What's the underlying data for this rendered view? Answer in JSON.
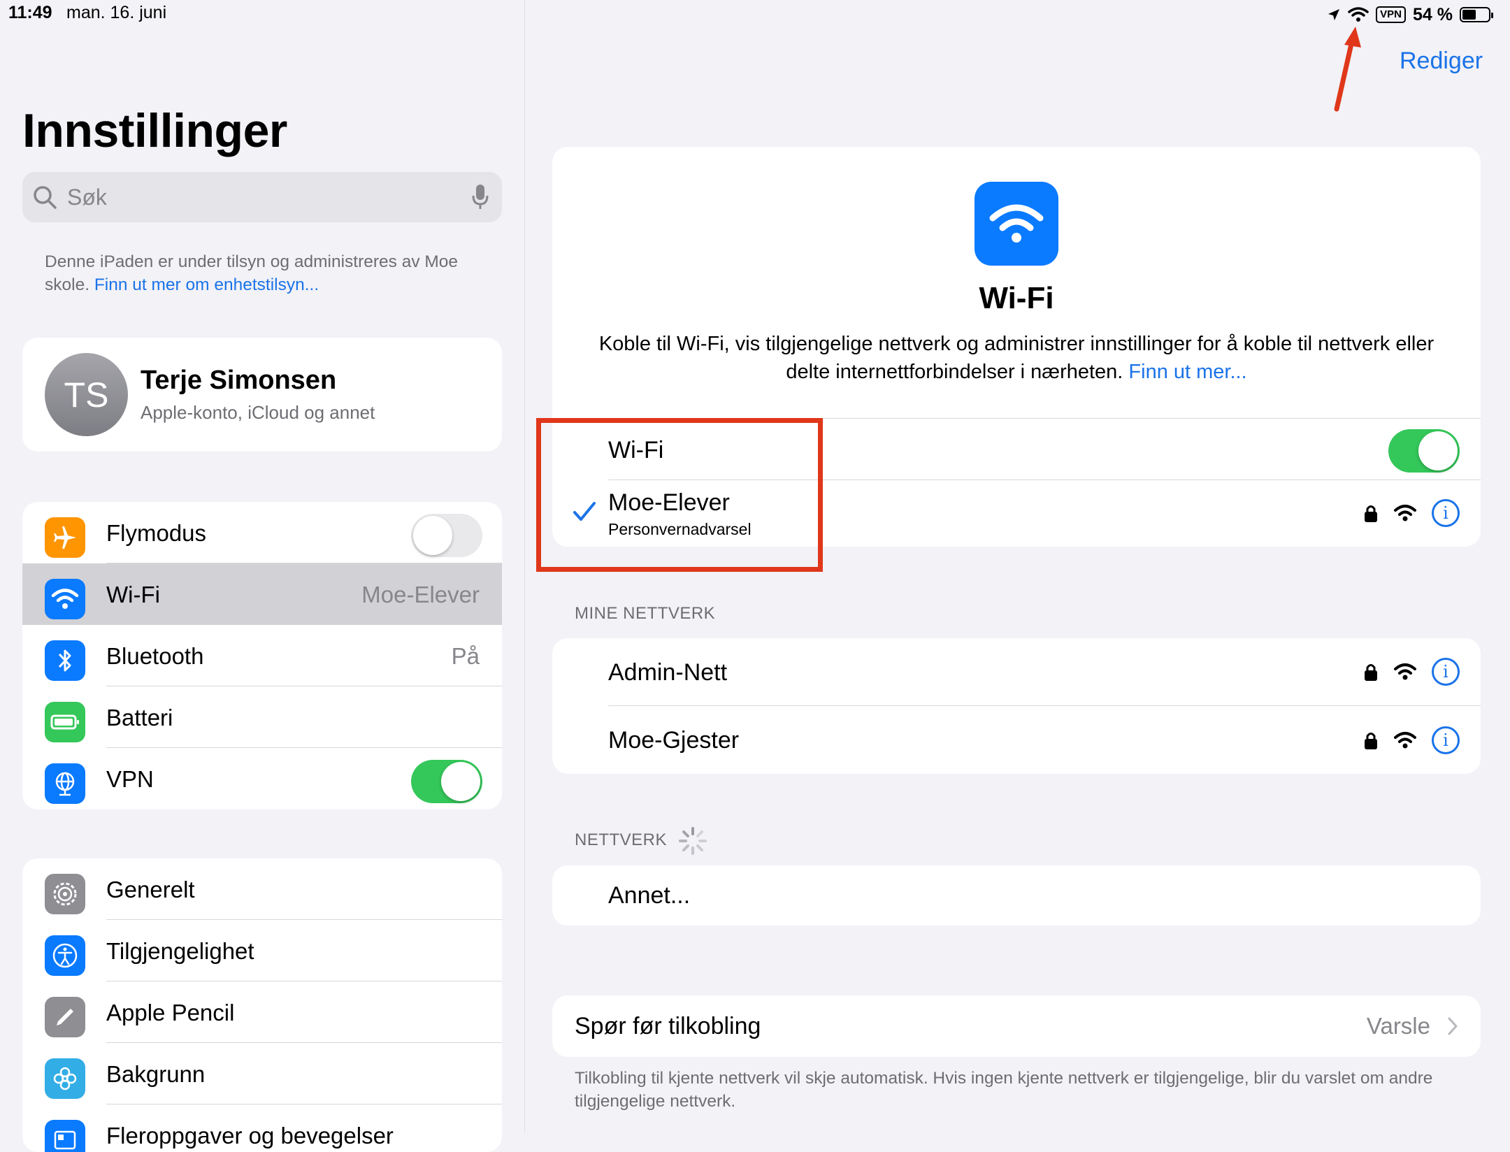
{
  "status": {
    "time": "11:49",
    "date": "man. 16. juni",
    "vpn": "VPN",
    "battery": "54 %",
    "battery_level": 0.54
  },
  "sidebar": {
    "title": "Innstillinger",
    "search_placeholder": "Søk",
    "supervision_text": "Denne iPaden er under tilsyn og administreres av Moe skole. ",
    "supervision_link": "Finn ut mer om enhetstilsyn...",
    "profile": {
      "initials": "TS",
      "name": "Terje Simonsen",
      "subtitle": "Apple-konto, iCloud og annet"
    },
    "group1": [
      {
        "label": "Flymodus",
        "value": "",
        "color": "#ff9500",
        "icon": "airplane-icon"
      },
      {
        "label": "Wi-Fi",
        "value": "Moe-Elever",
        "color": "#0a7aff",
        "icon": "wifi-icon"
      },
      {
        "label": "Bluetooth",
        "value": "På",
        "color": "#0a7aff",
        "icon": "bluetooth-icon"
      },
      {
        "label": "Batteri",
        "value": "",
        "color": "#34c759",
        "icon": "battery-icon"
      },
      {
        "label": "VPN",
        "value": "",
        "color": "#0a7aff",
        "icon": "globe-icon"
      }
    ],
    "group2": [
      {
        "label": "Generelt",
        "color": "#8e8e93",
        "icon": "gear-icon"
      },
      {
        "label": "Tilgjengelighet",
        "color": "#0a7aff",
        "icon": "accessibility-icon"
      },
      {
        "label": "Apple Pencil",
        "color": "#8e8e93",
        "icon": "pencil-icon"
      },
      {
        "label": "Bakgrunn",
        "color": "#32ade6",
        "icon": "flower-icon"
      },
      {
        "label": "Fleroppgaver og bevegelser",
        "color": "#0a7aff",
        "icon": "multitask-icon"
      }
    ]
  },
  "main": {
    "edit_label": "Rediger",
    "hero_title": "Wi-Fi",
    "hero_desc": "Koble til Wi-Fi, vis tilgjengelige nettverk og administrer innstillinger for å koble til nettverk eller delte internettforbindelser i nærheten. ",
    "hero_link": "Finn ut mer...",
    "wifi_label": "Wi-Fi",
    "connected": {
      "name": "Moe-Elever",
      "subtitle": "Personvernadvarsel"
    },
    "my_networks_header": "MINE NETTVERK",
    "my_networks": [
      "Admin-Nett",
      "Moe-Gjester"
    ],
    "networks_header": "NETTVERK",
    "other_label": "Annet...",
    "ask_label": "Spør før tilkobling",
    "ask_value": "Varsle",
    "ask_note": "Tilkobling til kjente nettverk vil skje automatisk. Hvis ingen kjente nettverk er tilgjengelige, blir du varslet om andre tilgjengelige nettverk.",
    "annotation_color": "#e0371b"
  }
}
